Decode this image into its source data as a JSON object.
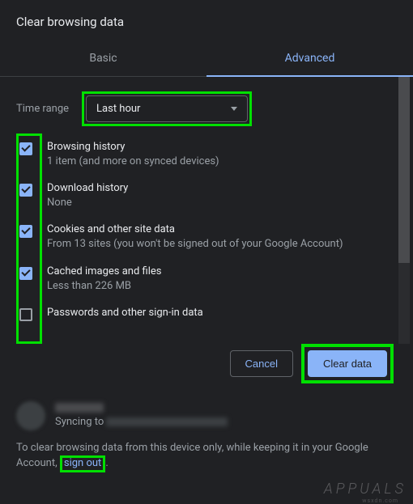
{
  "dialog": {
    "title": "Clear browsing data",
    "tabs": {
      "basic": "Basic",
      "advanced": "Advanced"
    },
    "active_tab": "advanced",
    "time_range_label": "Time range",
    "time_range_value": "Last hour",
    "options": [
      {
        "title": "Browsing history",
        "desc": "1 item (and more on synced devices)",
        "checked": true
      },
      {
        "title": "Download history",
        "desc": "None",
        "checked": true
      },
      {
        "title": "Cookies and other site data",
        "desc": "From 13 sites (you won't be signed out of your Google Account)",
        "checked": true
      },
      {
        "title": "Cached images and files",
        "desc": "Less than 226 MB",
        "checked": true
      },
      {
        "title": "Passwords and other sign-in data",
        "desc": "",
        "checked": false
      }
    ],
    "buttons": {
      "cancel": "Cancel",
      "clear": "Clear data"
    },
    "account": {
      "syncing_label": "Syncing to "
    },
    "info": {
      "prefix": "To clear browsing data from this device only, while keeping it in your Google Account, ",
      "signout": "sign out",
      "suffix": "."
    }
  },
  "watermark": {
    "brand": "APPUALS",
    "site": "wsxdn.com"
  }
}
